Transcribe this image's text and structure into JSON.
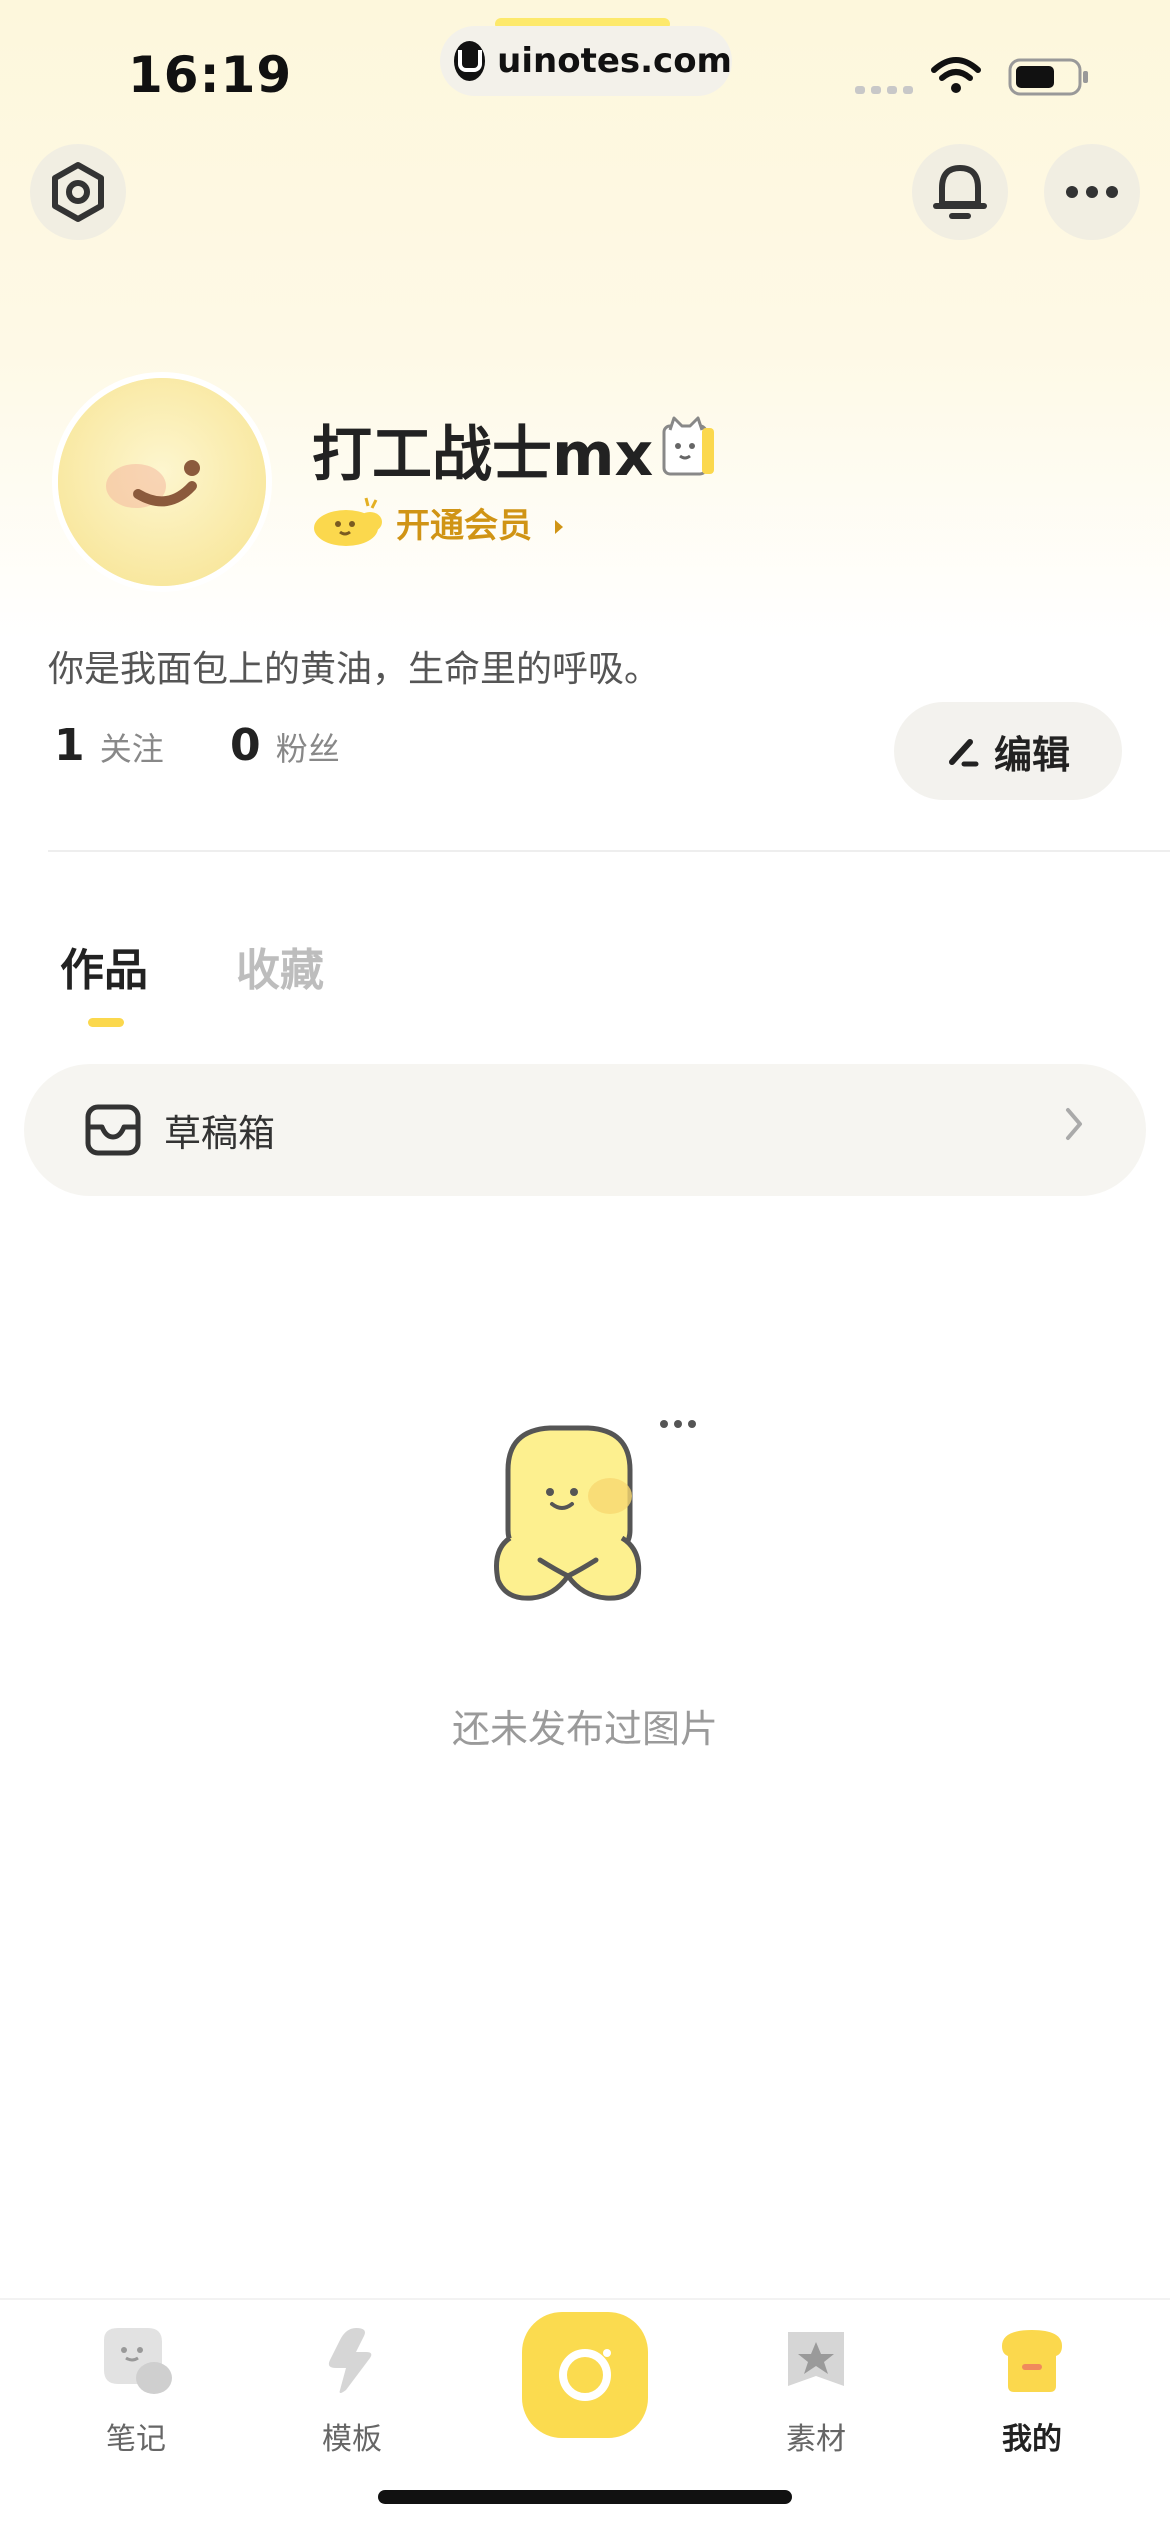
{
  "status_bar": {
    "time": "16:19",
    "url": "uinotes.com",
    "icons": [
      "cellular-icon",
      "wifi-icon",
      "battery-icon"
    ]
  },
  "header": {
    "left_icon": "settings-hexagon-icon",
    "right_icons": [
      "bell-icon",
      "more-icon"
    ]
  },
  "profile": {
    "username": "打工战士mx",
    "vip_label": "开通会员",
    "bio": "你是我面包上的黄油，生命里的呼吸。",
    "following_count": "1",
    "following_label": "关注",
    "followers_count": "0",
    "followers_label": "粉丝",
    "edit_label": "编辑"
  },
  "tabs": [
    {
      "label": "作品",
      "active": true
    },
    {
      "label": "收藏",
      "active": false
    }
  ],
  "drafts": {
    "label": "草稿箱"
  },
  "empty_state": {
    "text": "还未发布过图片"
  },
  "bottom_nav": {
    "items": [
      {
        "label": "笔记",
        "icon": "notes-icon"
      },
      {
        "label": "模板",
        "icon": "template-lightning-icon"
      },
      {
        "label": "",
        "icon": "camera-icon"
      },
      {
        "label": "素材",
        "icon": "material-star-icon"
      },
      {
        "label": "我的",
        "icon": "me-bread-icon",
        "active": true
      }
    ]
  },
  "colors": {
    "accent_yellow": "#fbd84d",
    "vip_orange": "#d09415",
    "header_bg": "#fdf7dc"
  }
}
